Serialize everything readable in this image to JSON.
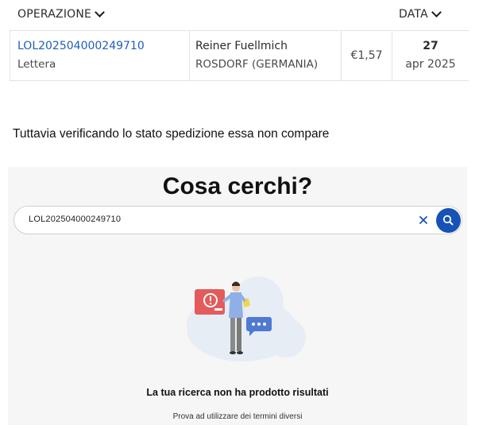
{
  "table": {
    "headers": {
      "operation": "OPERAZIONE",
      "date": "DATA"
    },
    "rows": [
      {
        "code": "LOL202504000249710",
        "type": "Lettera",
        "recipient_name": "Reiner Fuellmich",
        "recipient_place": "ROSDORF (GERMANIA)",
        "amount": "€1,57",
        "day": "27",
        "month_year": "apr 2025"
      }
    ]
  },
  "note": "Tuttavia verificando lo stato spedizione essa non compare",
  "search": {
    "title": "Cosa cerchi?",
    "query": "LOL202504000249710",
    "empty_title": "La tua ricerca non ha prodotto risultati",
    "empty_hint": "Prova ad utilizzare dei termini diversi"
  },
  "colors": {
    "link": "#1f5fb8",
    "search_button": "#1652b7",
    "panel_background": "#f6f6f7"
  }
}
